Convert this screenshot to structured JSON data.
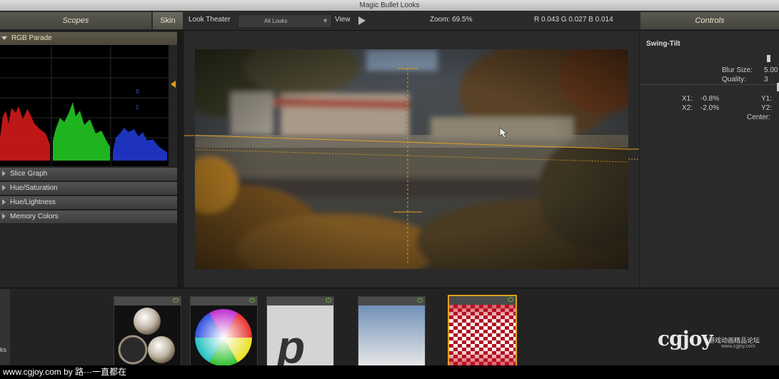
{
  "window": {
    "title": "Magic Bullet Looks"
  },
  "header": {
    "scopes_label": "Scopes",
    "skin_label": "Skin",
    "look_theater_label": "Look Theater",
    "looks_select_value": "All Looks",
    "view_label": "View",
    "zoom_text": "Zoom:   69.5%",
    "rgb_text": "R 0.043   G 0.027   B 0.014",
    "controls_label": "Controls"
  },
  "left_panel": {
    "scope_title": "RGB Parade",
    "sections": [
      "Slice Graph",
      "Hue/Saturation",
      "Hue/Lightness",
      "Memory Colors"
    ]
  },
  "controls": {
    "tool_name": "Swing-Tilt",
    "blur_size_label": "Blur Size:",
    "blur_size_value": "5.00",
    "quality_label": "Quality:",
    "quality_value": "3",
    "x1_label": "X1:",
    "x1_value": "-0.8%",
    "x2_label": "X2:",
    "x2_value": "-2.0%",
    "y1_label": "Y1:",
    "y2_label": "Y2:",
    "center_label": "Center:"
  },
  "tool_chain": {
    "tools": [
      "lens-tool",
      "color-wheel-tool",
      "pop-tool",
      "gradient-tool",
      "swing-tilt-tool"
    ]
  },
  "left_stub_text": "ks",
  "watermark": {
    "logo": "cgjoy",
    "subtitle": "游戏动画精品论坛",
    "url": "www.cgjoy.com"
  },
  "footer": {
    "text": "www.cgjoy.com by 路···一直都在"
  },
  "colors": {
    "accent": "#e0a020",
    "power_on": "#7fd043"
  }
}
